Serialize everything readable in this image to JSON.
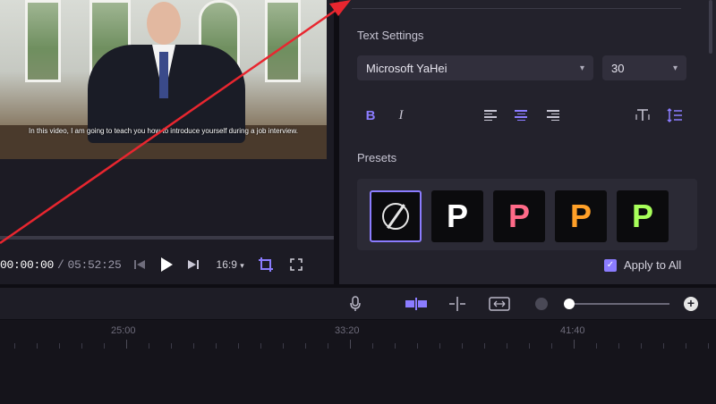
{
  "video": {
    "subtitle": "In this video, I am going to teach you how to introduce yourself during a job interview."
  },
  "player": {
    "current_time": "00:00:00",
    "separator": "/",
    "total_time": "05:52:25",
    "aspect_ratio": "16:9",
    "aspect_chevron": "▾",
    "prev_icon": "skip-back-icon",
    "play_icon": "play-icon",
    "next_icon": "skip-forward-icon"
  },
  "text_settings": {
    "title": "Text Settings",
    "font": "Microsoft YaHei",
    "size": "30",
    "bold": "B",
    "italic": "I"
  },
  "presets": {
    "title": "Presets",
    "items": [
      {
        "label": "",
        "kind": "none"
      },
      {
        "label": "P",
        "color": "#ffffff"
      },
      {
        "label": "P",
        "color": "#ff6a88"
      },
      {
        "label": "P",
        "color": "#ffa028"
      },
      {
        "label": "P",
        "color": "#a8ff5a"
      }
    ]
  },
  "apply_to_all": {
    "label": "Apply to All",
    "checked": true
  },
  "timeline": {
    "ruler_labels": [
      "25:00",
      "33:20",
      "41:40"
    ],
    "tools": [
      "microphone-icon",
      "split-clip-icon",
      "add-marker-icon",
      "fit-timeline-icon"
    ]
  },
  "colors": {
    "accent": "#8b7cff",
    "annotation_arrow": "#e8262f"
  }
}
